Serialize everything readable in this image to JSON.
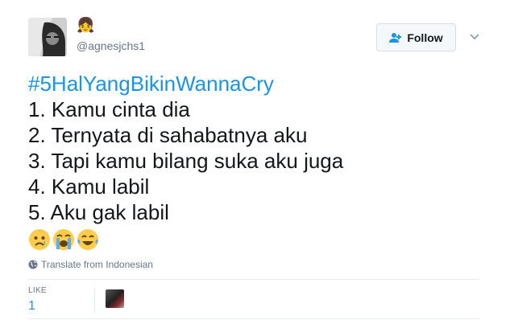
{
  "user": {
    "name_emoji": "👧",
    "handle": "@agnesjchs1"
  },
  "follow_button": {
    "label": "Follow",
    "icon": "follow-user-icon"
  },
  "menu": {
    "icon": "chevron-down-icon"
  },
  "tweet": {
    "hashtag": "#5HalYangBikinWannaCry",
    "lines": [
      "1. Kamu cinta dia",
      "2. Ternyata di sahabatnya aku",
      "3. Tapi kamu bilang suka aku juga",
      "4. Kamu labil",
      "5. Aku gak labil"
    ],
    "emojis": [
      "crying-face-icon",
      "loudly-crying-face-icon",
      "tears-of-joy-icon"
    ]
  },
  "translate": {
    "label": "Translate from Indonesian",
    "icon": "globe-icon"
  },
  "stats": {
    "likes_label": "LIKE",
    "likes_count": "1"
  },
  "colors": {
    "link_blue": "#1b95e0",
    "muted_gray": "#657786",
    "divider": "#e6ecf0"
  }
}
